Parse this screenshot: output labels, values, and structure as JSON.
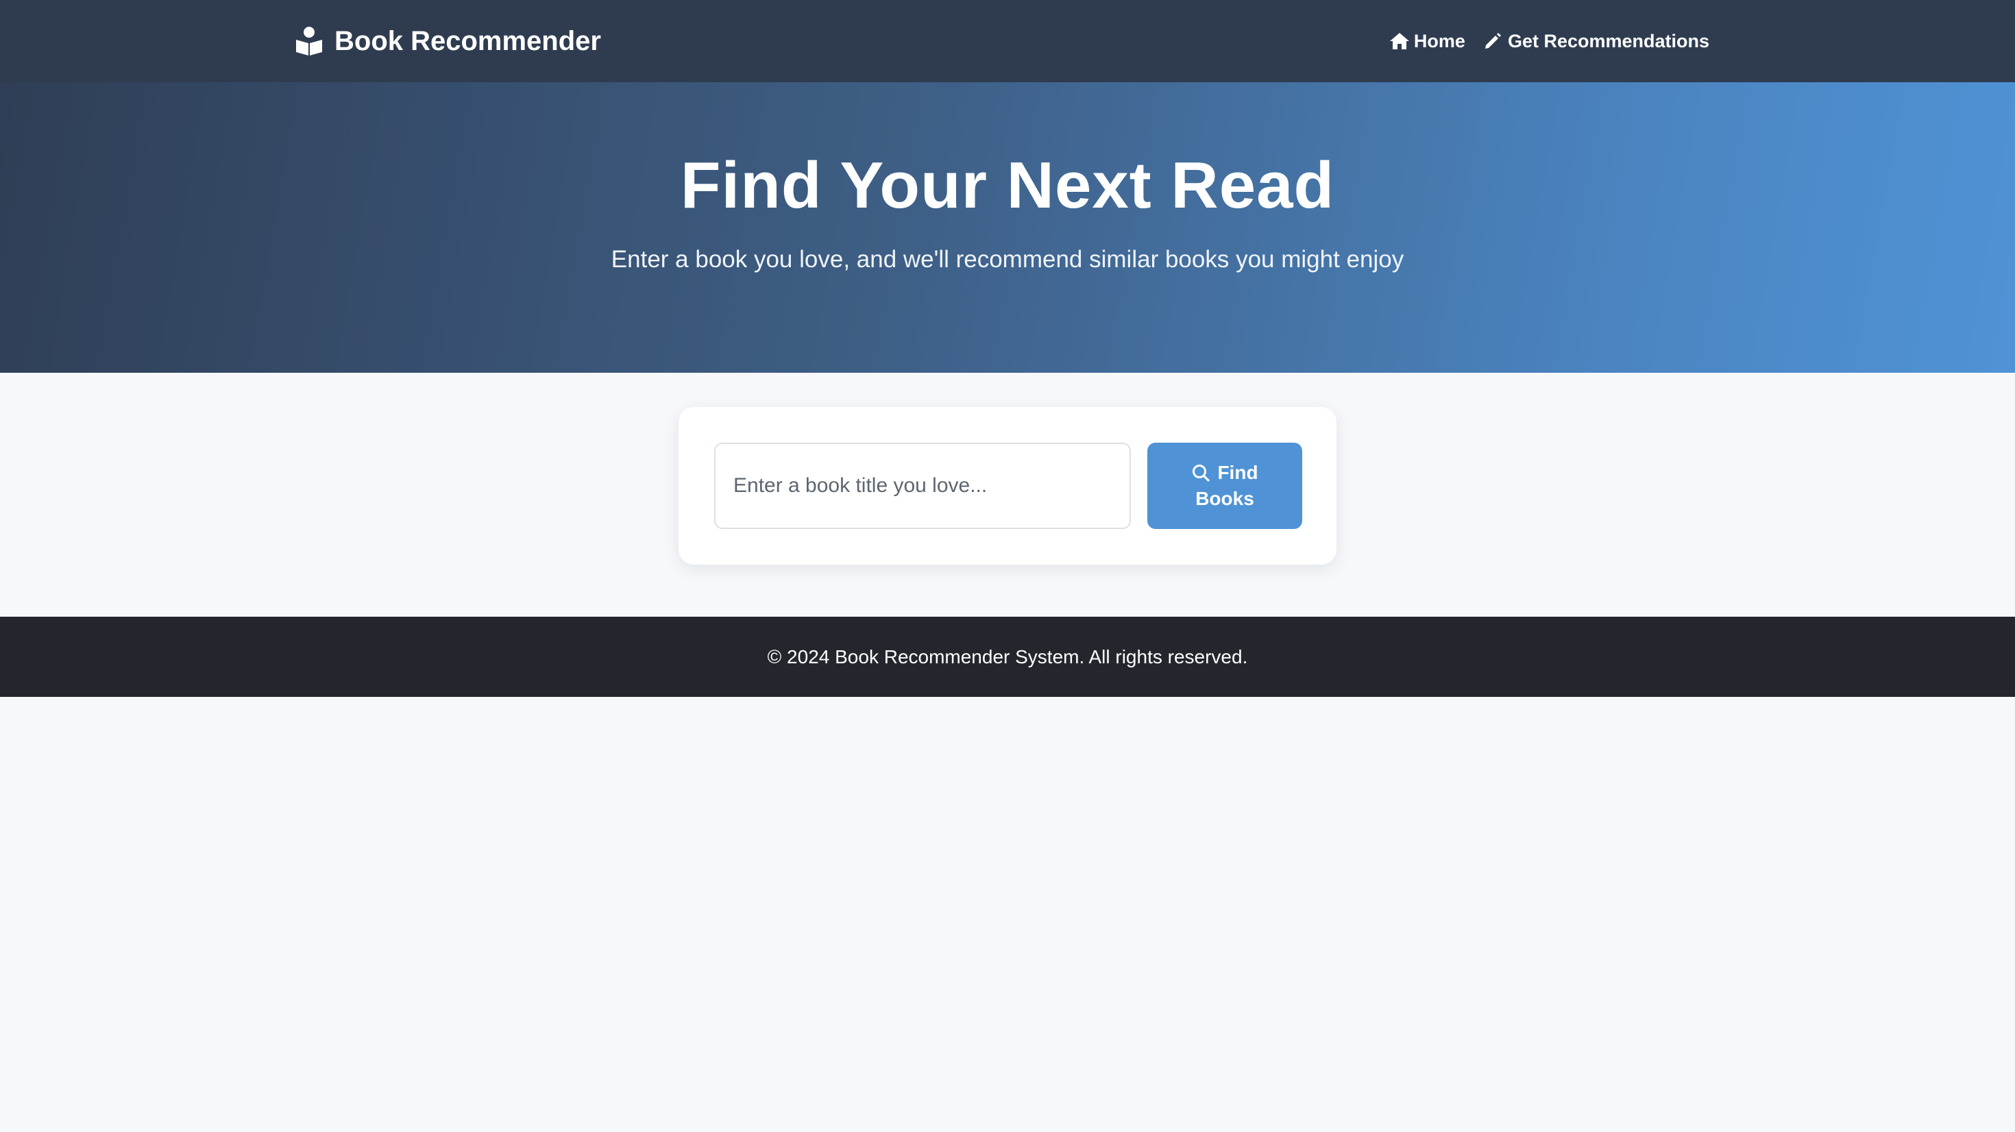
{
  "navbar": {
    "brand": "Book Recommender",
    "brand_icon": "book-reader-icon",
    "links": [
      {
        "label": "Home",
        "icon": "home-icon"
      },
      {
        "label": "Get Recommendations",
        "icon": "pencil-icon"
      }
    ]
  },
  "hero": {
    "title": "Find Your Next Read",
    "subtitle": "Enter a book you love, and we'll recommend similar books you might enjoy"
  },
  "search": {
    "placeholder": "Enter a book title you love...",
    "value": "",
    "button_line1": "Find",
    "button_line2": "Books",
    "button_icon": "search-icon"
  },
  "footer": {
    "text": "© 2024 Book Recommender System. All rights reserved."
  },
  "colors": {
    "navbar_bg": "#2f3c50",
    "hero_gradient_start": "#2f3e55",
    "hero_gradient_end": "#4f93d6",
    "accent": "#4f93d6",
    "footer_bg": "#23272d",
    "page_bg": "#f7f8fa"
  }
}
